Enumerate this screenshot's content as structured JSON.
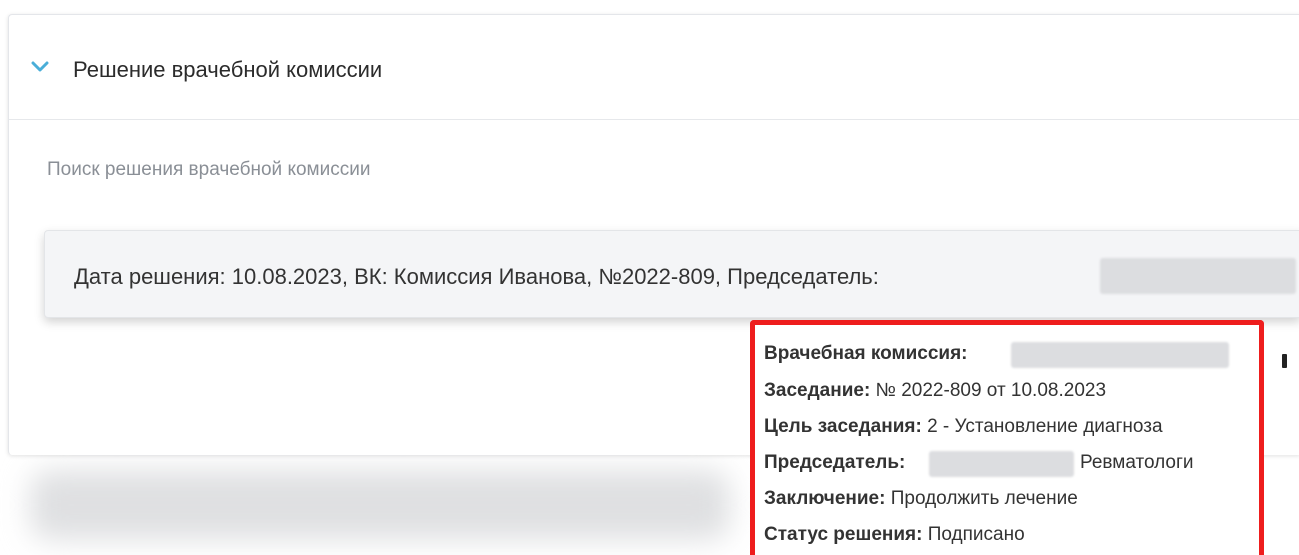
{
  "section": {
    "title": "Решение врачебной комиссии",
    "icon": "chevron-down-icon",
    "accent_color": "#4aaed8"
  },
  "search": {
    "label": "Поиск решения врачебной комиссии",
    "value": ""
  },
  "dropdown": {
    "option_text": "Дата решения: 10.08.2023, ВК: Комиссия Иванова, №2022-809, Председатель:"
  },
  "tooltip": {
    "border_color": "#ee1d1d",
    "commission_label": "Врачебная комиссия:",
    "meeting_label": "Заседание:",
    "meeting_value": "№ 2022-809 от 10.08.2023",
    "purpose_label": "Цель заседания:",
    "purpose_value": "2 - Установление диагноза",
    "chairman_label": "Председатель:",
    "chairman_value": "Ревматологи",
    "conclusion_label": "Заключение:",
    "conclusion_value": "Продолжить лечение",
    "status_label": "Статус решения:",
    "status_value": "Подписано"
  }
}
